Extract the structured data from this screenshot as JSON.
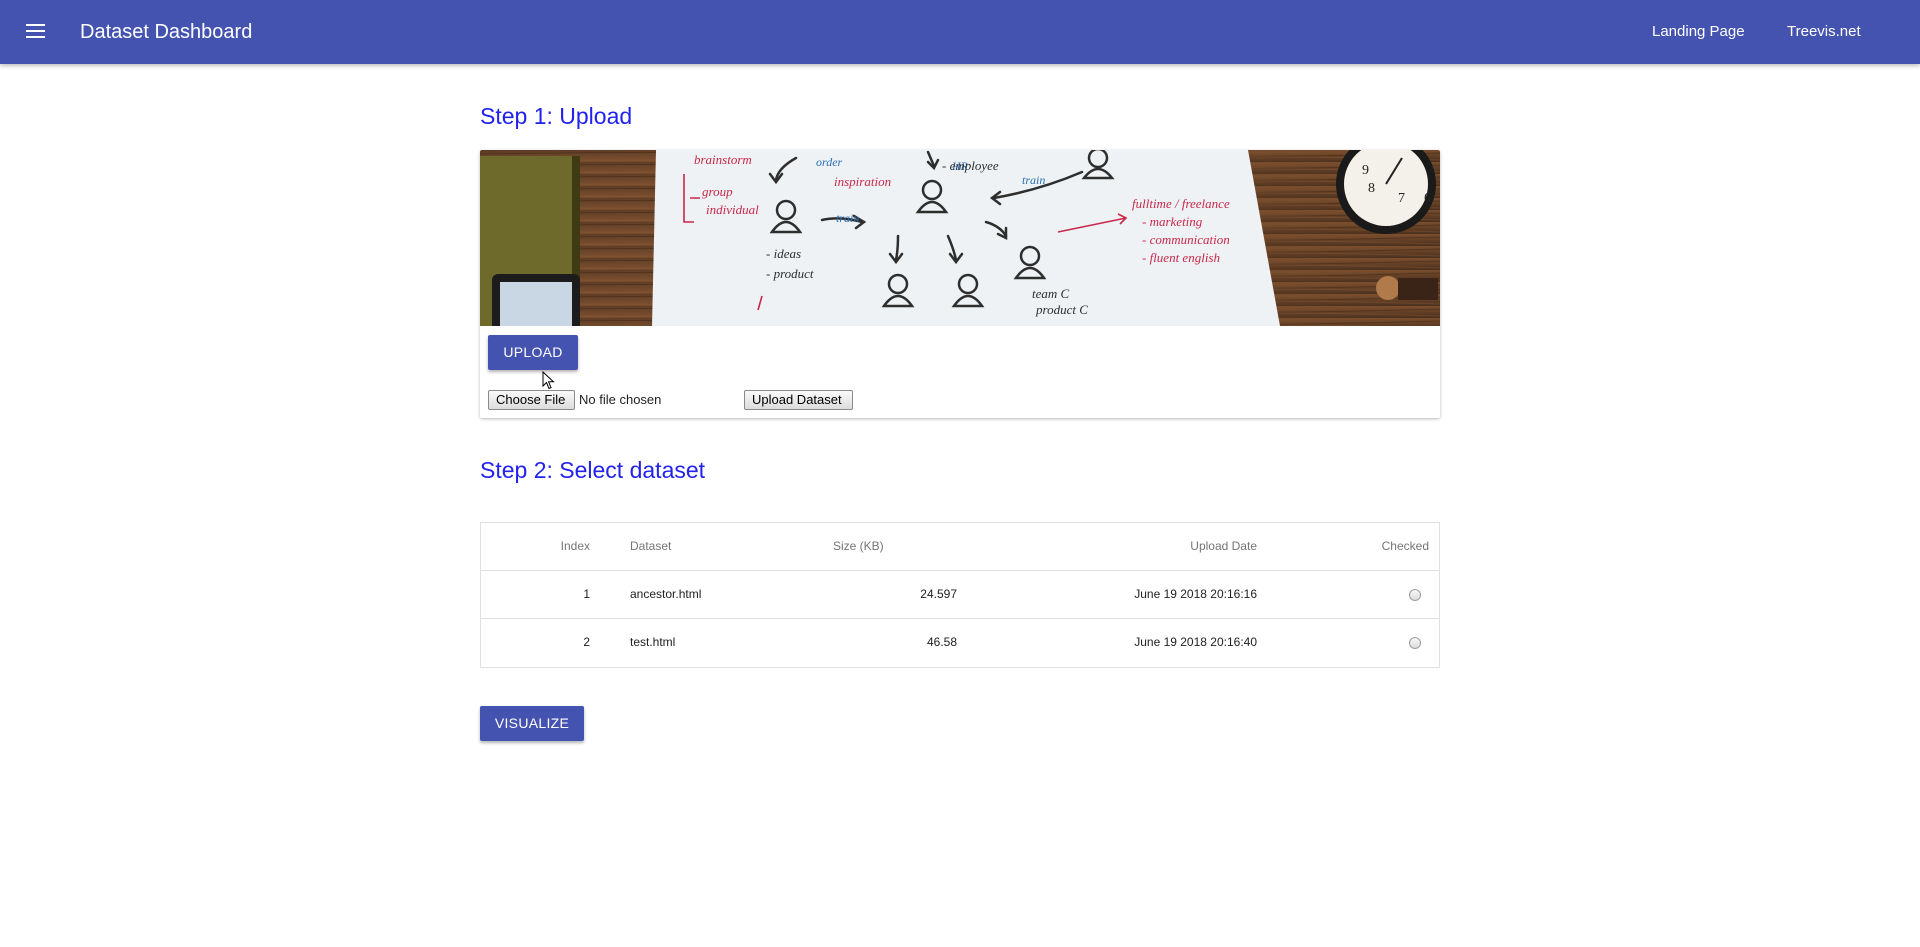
{
  "appbar": {
    "title": "Dataset Dashboard",
    "menu_icon": "hamburger-menu-icon",
    "links": [
      {
        "label": "Landing Page"
      },
      {
        "label": "Treevis.net"
      }
    ],
    "color": "#4453b0"
  },
  "step1": {
    "heading": "Step 1: Upload",
    "upload_button": "Upload",
    "choose_file_button": "Choose File",
    "file_status": "No file chosen",
    "upload_dataset_button": "Upload Dataset"
  },
  "step2": {
    "heading": "Step 2: Select dataset",
    "table": {
      "headers": {
        "index": "Index",
        "dataset": "Dataset",
        "size": "Size (KB)",
        "upload_date": "Upload Date",
        "checked": "Checked"
      },
      "rows": [
        {
          "index": "1",
          "dataset": "ancestor.html",
          "size": "24.597",
          "upload_date": "June 19 2018 20:16:16",
          "checked": false
        },
        {
          "index": "2",
          "dataset": "test.html",
          "size": "46.58",
          "upload_date": "June 19 2018 20:16:40",
          "checked": false
        }
      ]
    }
  },
  "visualize_button": "Visualize",
  "colors": {
    "accent": "#4453b0",
    "heading": "#2222ee"
  }
}
